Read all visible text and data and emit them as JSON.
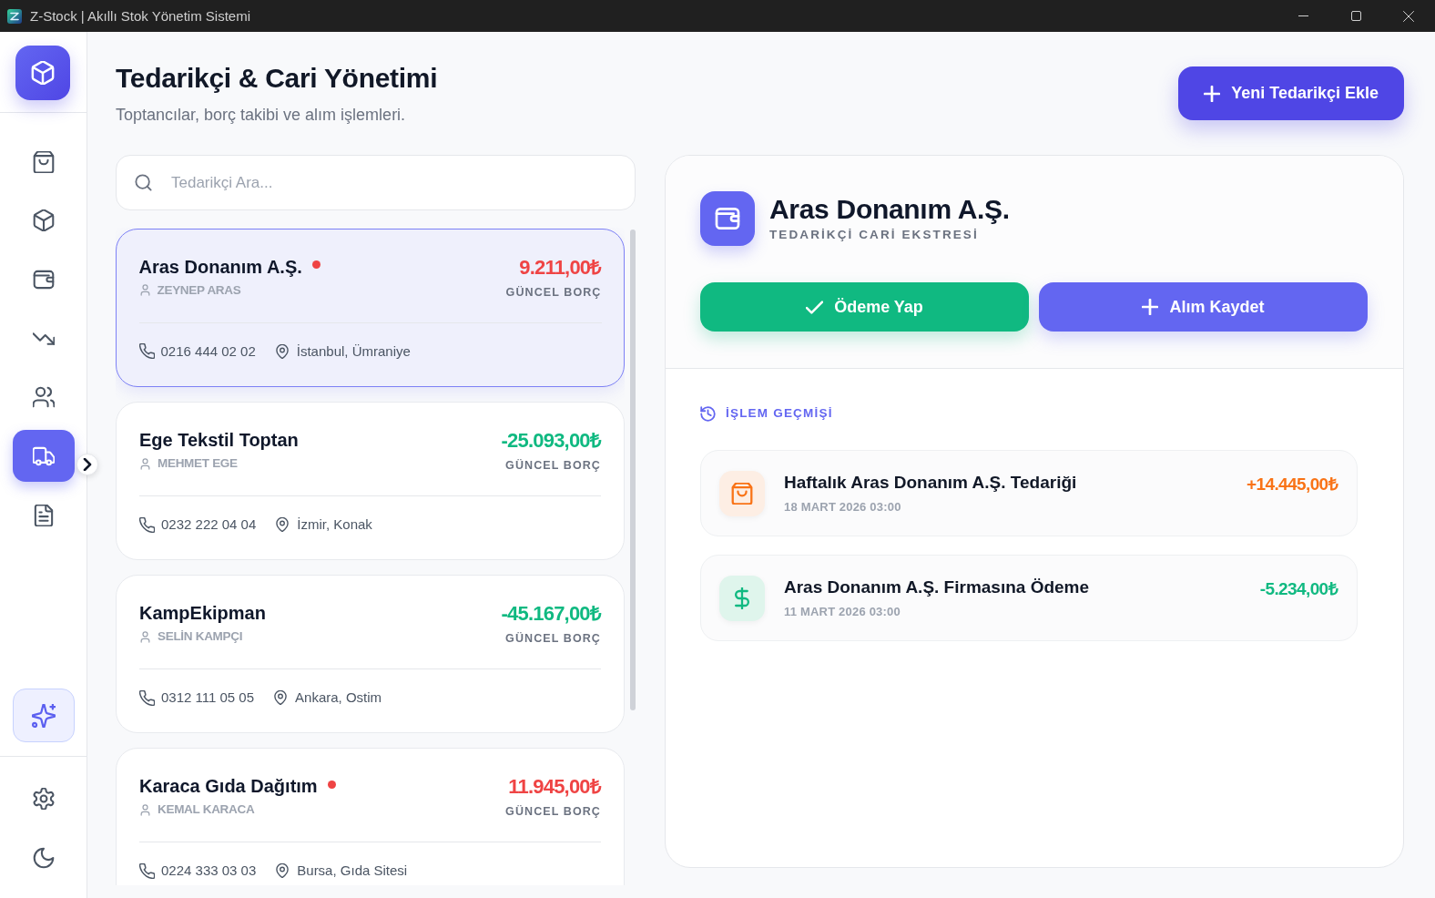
{
  "window": {
    "title": "Z-Stock | Akıllı Stok Yönetim Sistemi"
  },
  "sidebar": {
    "items": [
      {
        "kind": "bag",
        "selected": false
      },
      {
        "kind": "cube",
        "selected": false
      },
      {
        "kind": "wallet",
        "selected": false
      },
      {
        "kind": "trend",
        "selected": false
      },
      {
        "kind": "users",
        "selected": false
      },
      {
        "kind": "truck",
        "selected": true
      },
      {
        "kind": "document",
        "selected": false
      }
    ]
  },
  "header": {
    "title": "Tedarikçi & Cari Yönetimi",
    "subtitle": "Toptancılar, borç takibi ve alım işlemleri.",
    "add_button": "Yeni Tedarikçi Ekle"
  },
  "search": {
    "placeholder": "Tedarikçi Ara..."
  },
  "suppliers": [
    {
      "name": "Aras Donanım A.Ş.",
      "flagged": true,
      "contact": "ZEYNEP ARAS",
      "balance": "9.211,00₺",
      "color": "#ef4444",
      "balance_label": "GÜNCEL BORÇ",
      "phone": "0216 444 02 02",
      "location": "İstanbul, Ümraniye",
      "selected": true
    },
    {
      "name": "Ege Tekstil Toptan",
      "flagged": false,
      "contact": "MEHMET EGE",
      "balance": "-25.093,00₺",
      "color": "#10b981",
      "balance_label": "GÜNCEL BORÇ",
      "phone": "0232 222 04 04",
      "location": "İzmir, Konak",
      "selected": false
    },
    {
      "name": "KampEkipman",
      "flagged": false,
      "contact": "SELİN KAMPÇI",
      "balance": "-45.167,00₺",
      "color": "#10b981",
      "balance_label": "GÜNCEL BORÇ",
      "phone": "0312 111 05 05",
      "location": "Ankara, Ostim",
      "selected": false
    },
    {
      "name": "Karaca Gıda Dağıtım",
      "flagged": true,
      "contact": "KEMAL KARACA",
      "balance": "11.945,00₺",
      "color": "#ef4444",
      "balance_label": "GÜNCEL BORÇ",
      "phone": "0224 333 03 03",
      "location": "Bursa, Gıda Sitesi",
      "selected": false
    }
  ],
  "detail": {
    "name": "Aras Donanım A.Ş.",
    "subtitle": "TEDARİKÇİ CARİ EKSTRESİ",
    "buttons": [
      {
        "kind": "payment",
        "label": "Ödeme Yap"
      },
      {
        "kind": "purchase",
        "label": "Alım Kaydet"
      }
    ],
    "history_title": "İŞLEM GEÇMİŞİ",
    "transactions": [
      {
        "kind": "purchase",
        "title": "Haftalık Aras Donanım A.Ş. Tedariği",
        "date": "18 MART 2026 03:00",
        "amount": "+14.445,00₺"
      },
      {
        "kind": "payment",
        "title": "Aras Donanım A.Ş. Firmasına Ödeme",
        "date": "11 MART 2026 03:00",
        "amount": "-5.234,00₺"
      }
    ]
  }
}
